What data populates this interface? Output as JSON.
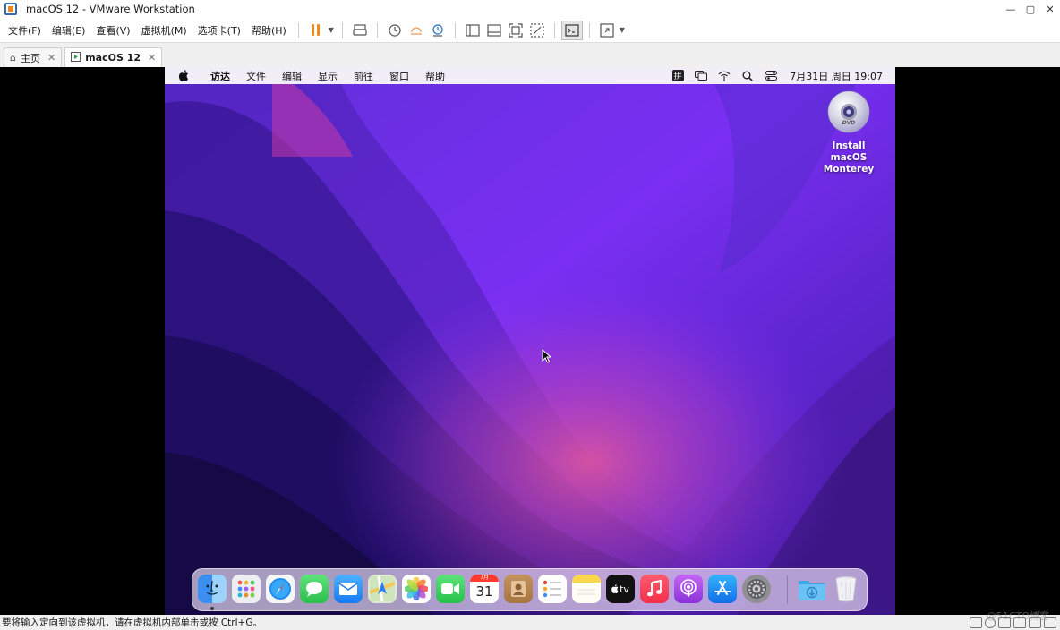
{
  "window": {
    "title": "macOS 12 - VMware Workstation",
    "controls": {
      "minimize": "—",
      "maximize": "▢",
      "close": "✕"
    }
  },
  "menu": [
    "文件(F)",
    "编辑(E)",
    "查看(V)",
    "虚拟机(M)",
    "选项卡(T)",
    "帮助(H)"
  ],
  "toolbar": {
    "icons": [
      "pause-icon",
      "send-ctrl-alt-del-icon",
      "snapshot-take-icon",
      "snapshot-revert-icon",
      "snapshot-manager-icon",
      "library-icon",
      "thumbnail-bar-icon",
      "full-screen-icon",
      "unity-icon",
      "console-icon",
      "stretch-guest-icon"
    ]
  },
  "tabs": [
    {
      "label": "主页",
      "icon": "home-icon",
      "active": false
    },
    {
      "label": "macOS 12",
      "icon": "vm-icon",
      "active": true
    }
  ],
  "mac": {
    "menubar": {
      "app": "访达",
      "items": [
        "文件",
        "编辑",
        "显示",
        "前往",
        "窗口",
        "帮助"
      ],
      "input_method": "拼",
      "clock": "7月31日 周日  19:07"
    },
    "desktop_items": [
      {
        "label": "Install macOS Monterey",
        "icon": "dvd-icon"
      }
    ],
    "dock": {
      "apps": [
        "Finder",
        "Launchpad",
        "Safari",
        "Messages",
        "Mail",
        "Maps",
        "Photos",
        "FaceTime",
        "Calendar",
        "Contacts",
        "Reminders",
        "Notes",
        "TV",
        "Music",
        "Podcasts",
        "App Store",
        "System Preferences",
        "Downloads",
        "Trash"
      ],
      "calendar_month": "7月",
      "calendar_day": "31",
      "tv_label": "tv"
    }
  },
  "statusbar": {
    "text": "要将输入定向到该虚拟机，请在虚拟机内部单击或按 Ctrl+G。"
  },
  "watermark": "@51CTO博客"
}
